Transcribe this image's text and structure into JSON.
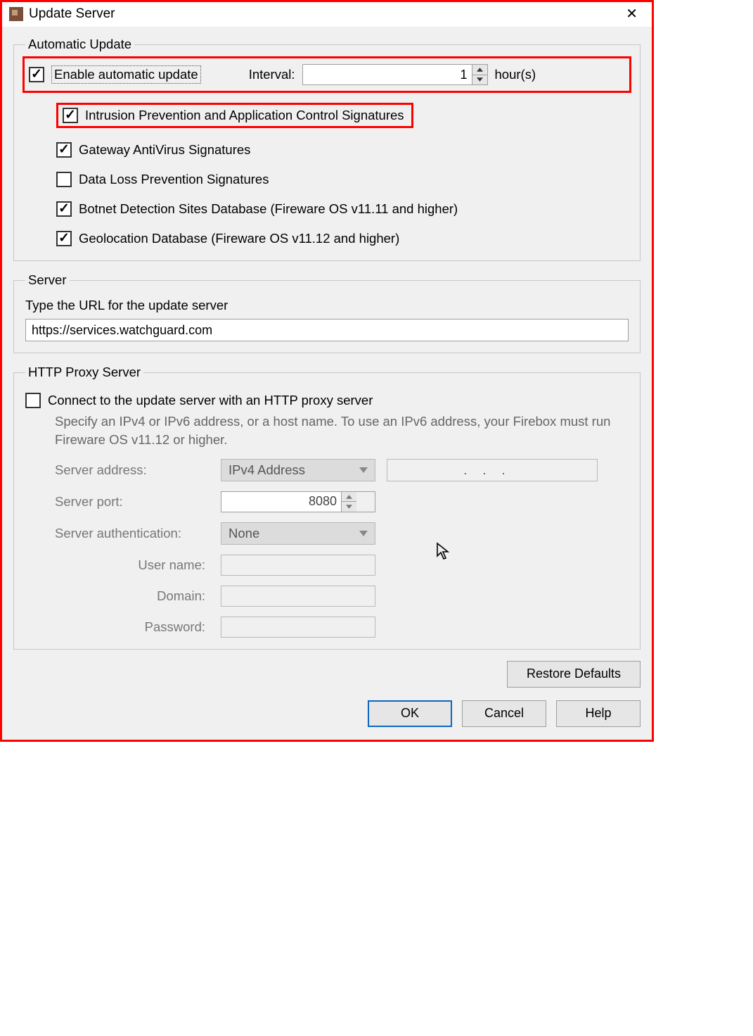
{
  "window": {
    "title": "Update Server"
  },
  "auto": {
    "legend": "Automatic Update",
    "enable_label": "Enable automatic update",
    "enable_checked": true,
    "interval_label": "Interval:",
    "interval_value": "1",
    "interval_unit": "hour(s)",
    "items": [
      {
        "label": "Intrusion Prevention and Application Control Signatures",
        "checked": true,
        "highlight": true
      },
      {
        "label": "Gateway AntiVirus Signatures",
        "checked": true
      },
      {
        "label": "Data Loss Prevention Signatures",
        "checked": false
      },
      {
        "label": "Botnet Detection Sites Database (Fireware OS v11.11 and higher)",
        "checked": true
      },
      {
        "label": "Geolocation Database (Fireware OS v11.12 and higher)",
        "checked": true
      }
    ]
  },
  "server": {
    "legend": "Server",
    "prompt": "Type the URL for the update server",
    "url": "https://services.watchguard.com"
  },
  "proxy": {
    "legend": "HTTP Proxy Server",
    "connect_label": "Connect to the update server with an HTTP proxy server",
    "connect_checked": false,
    "help": "Specify an IPv4 or IPv6 address, or a host name. To use an IPv6 address, your Firebox must run Fireware OS v11.12 or higher.",
    "addr_label": "Server address:",
    "addr_type": "IPv4 Address",
    "port_label": "Server port:",
    "port_value": "8080",
    "auth_label": "Server authentication:",
    "auth_value": "None",
    "user_label": "User name:",
    "domain_label": "Domain:",
    "password_label": "Password:"
  },
  "buttons": {
    "restore": "Restore Defaults",
    "ok": "OK",
    "cancel": "Cancel",
    "help": "Help"
  }
}
